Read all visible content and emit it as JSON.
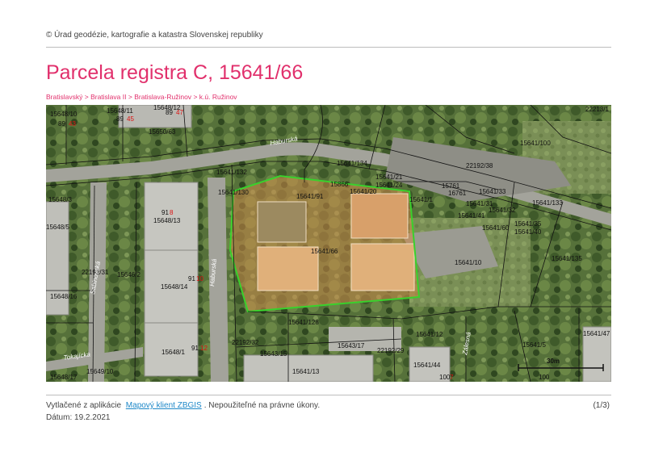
{
  "header": {
    "copyright": "© Úrad geodézie, kartografie a katastra Slovenskej republiky",
    "title": "Parcela registra C, 15641/66",
    "breadcrumb": [
      "Bratislavský",
      "Bratislava II",
      "Bratislava-Ružinov",
      "k.ú. Ružinov"
    ],
    "breadcrumb_separator": ">"
  },
  "map": {
    "highlight_color": "#39d12c",
    "parcel_labels": [
      "15648/10",
      "89",
      "43",
      "15648/11",
      "89",
      "45",
      "15648/12",
      "89",
      "47",
      "15650/63",
      "15641/132",
      "15641/130",
      "15641/134",
      "22192/38",
      "15641/133",
      "22192/32",
      "15641/128",
      "15648/3",
      "15648/13",
      "91",
      "8",
      "15648/5",
      "22192/31",
      "15646/2",
      "15648/14",
      "91",
      "10",
      "15648/16",
      "15648/1",
      "91",
      "12",
      "15641/66",
      "15641/10",
      "15641/135",
      "15641/12",
      "15641/5",
      "15643/15",
      "15643/17",
      "22192/29",
      "15641/13",
      "15641/44",
      "100",
      "7",
      "15641/47",
      "15649/10",
      "15648/17",
      "15866",
      "15761",
      "16761",
      "22213/1",
      "15641/100",
      "15641/91",
      "15641/35",
      "15641/40",
      "15641/41",
      "15641/60",
      "15641/21",
      "15641/24",
      "15641/20",
      "15641/31",
      "15641/32",
      "15641/33",
      "15641/1",
      "100"
    ],
    "street_labels": [
      "Haburská",
      "Sabinovská",
      "Haburská",
      "Tokajícka",
      "Zálesná"
    ],
    "scale_label": "30m"
  },
  "footer": {
    "printed_prefix": "Vytlačené z aplikácie",
    "app_link": "Mapový klient ZBGIS",
    "printed_suffix": ". Nepoužiteľné na právne úkony.",
    "page": "(1/3)",
    "date": "Dátum: 19.2.2021"
  }
}
